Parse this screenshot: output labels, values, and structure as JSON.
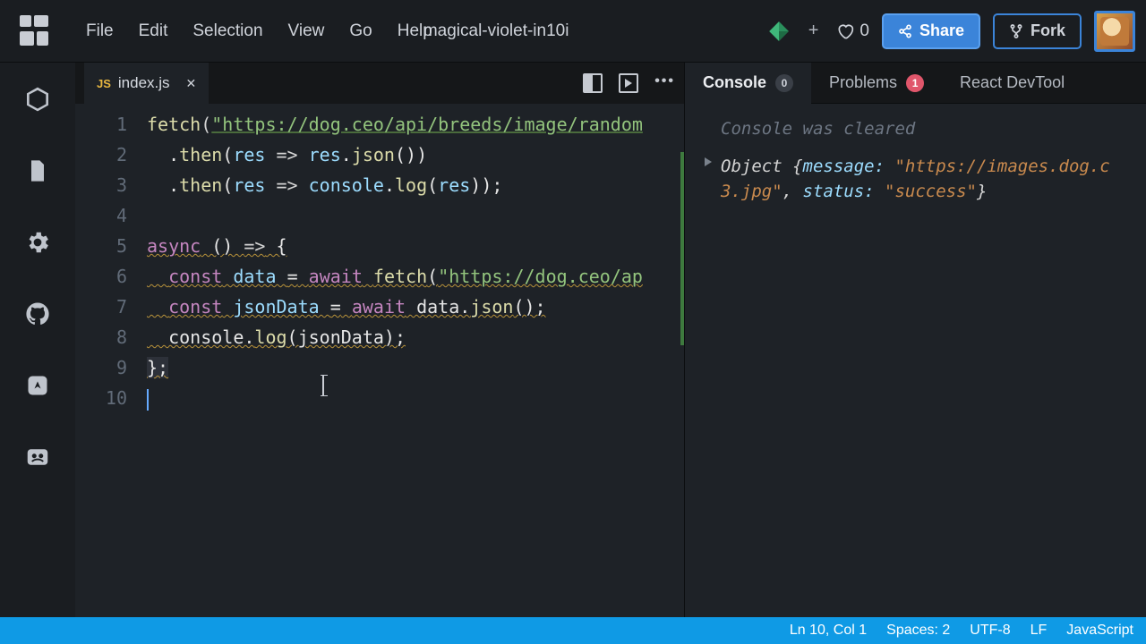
{
  "menu": {
    "file": "File",
    "edit": "Edit",
    "selection": "Selection",
    "view": "View",
    "go": "Go",
    "help": "Help"
  },
  "sandbox_title": "magical-violet-in10i",
  "likes": "0",
  "buttons": {
    "share": "Share",
    "fork": "Fork"
  },
  "file_tab": {
    "badge": "JS",
    "name": "index.js"
  },
  "code": {
    "l1a": "fetch",
    "l1b": "(",
    "l1c": "\"https://dog.ceo/api/breeds/image/random",
    "l2a": "  .",
    "l2b": "then",
    "l2c": "(",
    "l2d": "res",
    "l2e": " => ",
    "l2f": "res",
    "l2g": ".",
    "l2h": "json",
    "l2i": "())",
    "l3a": "  .",
    "l3b": "then",
    "l3c": "(",
    "l3d": "res",
    "l3e": " => ",
    "l3f": "console",
    "l3g": ".",
    "l3h": "log",
    "l3i": "(",
    "l3j": "res",
    "l3k": "));",
    "l5a": "async",
    "l5b": " () ",
    "l5c": "=>",
    "l5d": " {",
    "l6a": "  ",
    "l6b": "const",
    "l6c": " data ",
    "l6d": "=",
    "l6e": " ",
    "l6f": "await",
    "l6g": " ",
    "l6h": "fetch",
    "l6i": "(",
    "l6j": "\"https://dog.ceo/ap",
    "l7a": "  ",
    "l7b": "const",
    "l7c": " jsonData ",
    "l7d": "=",
    "l7e": " ",
    "l7f": "await",
    "l7g": " data.",
    "l7h": "json",
    "l7i": "();",
    "l8a": "  console.",
    "l8b": "log",
    "l8c": "(jsonData);",
    "l9a": "};"
  },
  "line_numbers": [
    "1",
    "2",
    "3",
    "4",
    "5",
    "6",
    "7",
    "8",
    "9",
    "10"
  ],
  "console": {
    "tabs": {
      "console": "Console",
      "console_count": "0",
      "problems": "Problems",
      "problems_count": "1",
      "react": "React DevTool"
    },
    "cleared": "Console was cleared",
    "obj_prefix": "Object ",
    "obj_open": "{",
    "k1": "message:",
    "v1": " \"https://images.dog.c",
    "v1b": "3.jpg\"",
    "sep": ", ",
    "k2": "status:",
    "v2": " \"success\"",
    "obj_close": "}"
  },
  "status": {
    "pos": "Ln 10, Col 1",
    "spaces": "Spaces: 2",
    "enc": "UTF-8",
    "eol": "LF",
    "lang": "JavaScript"
  }
}
